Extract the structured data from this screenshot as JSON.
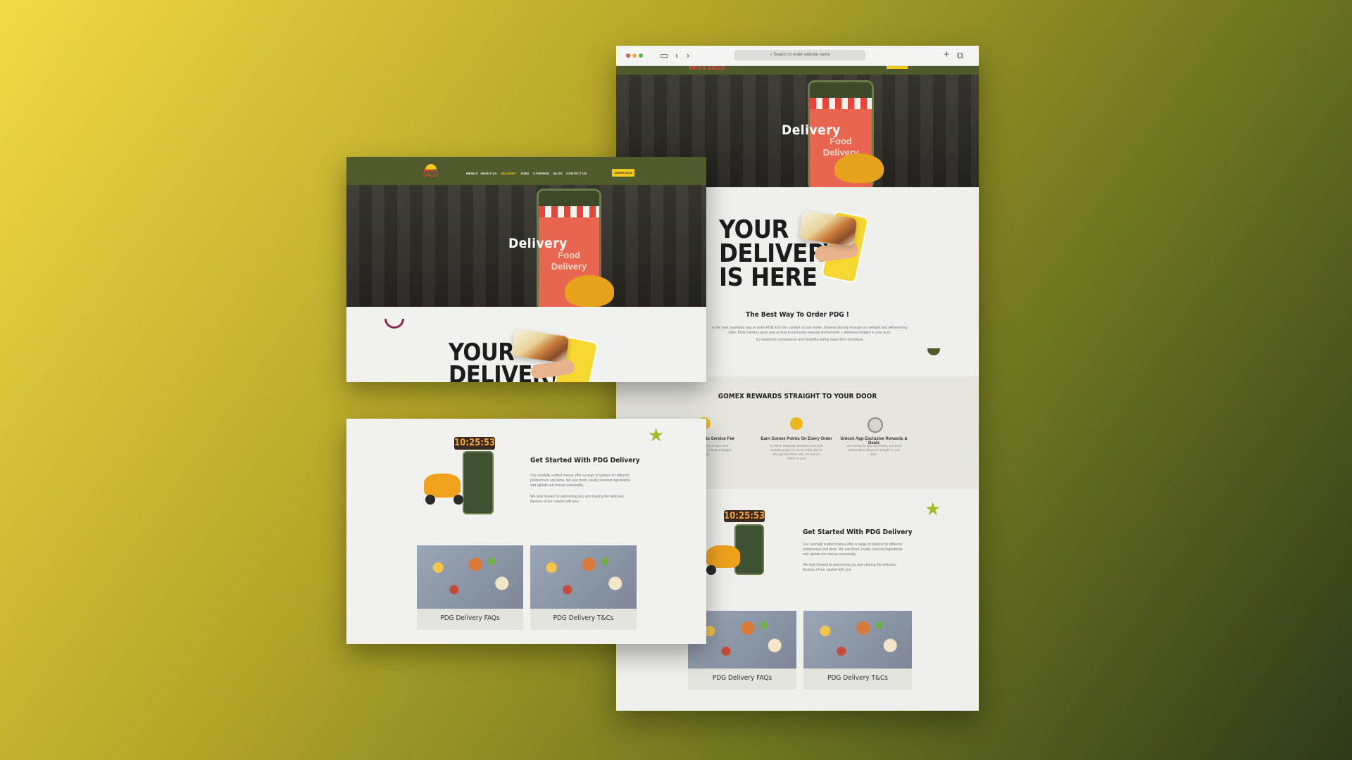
{
  "browser": {
    "url_placeholder": "Search or enter website name"
  },
  "site": {
    "brand": "PICO & GALLO",
    "nav": [
      "MENUS",
      "ABOUT US",
      "DELIVERY",
      "JOBS",
      "CATERING",
      "BLOG",
      "CONTACT US"
    ],
    "order_button": "ORDER NOW",
    "hero_title": "Delivery",
    "hero_graphic_line1": "Food",
    "hero_graphic_line2": "Delivery",
    "headline_line1": "YOUR",
    "headline_line2": "DELIVERY",
    "headline_line3": "IS HERE",
    "best_way_title": "The Best Way To Order PDG !",
    "intro_text": "is the new, seamless way to order PDG from the comfort of your home. Ordered directly through our website and delivered by Uber, PDG Delivery gives you access to exclusive rewards and benefits – delivered straight to your door.",
    "intro_text2": "It's maximum convenience and beautiful eating value all in one place.",
    "rewards_title": "GOMEX REWARDS STRAIGHT TO YOUR DOOR",
    "rewards": [
      {
        "label": "Delivery Fee & No Service Fee",
        "desc": "Enjoy your order without extra fees. Just a simple, flat fee to keep it budget friendly!"
      },
      {
        "label": "Earn Gomex Points On Every Order",
        "desc": "GOMEX Rewards members earn and redeem points on every order placed through the PDG web. Oh and it's FREE to join!"
      },
      {
        "label": "Unlock App Exclusive Rewards & Deals",
        "desc": "Get access to app exclusives, products and bundles delivered straight to your door."
      }
    ],
    "timer": "10:25:53",
    "get_started_title": "Get Started With PDG Delivery",
    "get_started_text1": "Our carefully crafted menus offer a range of options for different preferences and diets. We use fresh, locally sourced ingredients and update our menus seasonally.",
    "get_started_text2": "We look forward to welcoming you and sharing the delicious flavours of our cuisine with you.",
    "tile1": "PDG Delivery FAQs",
    "tile2": "PDG Delivery T&Cs"
  }
}
